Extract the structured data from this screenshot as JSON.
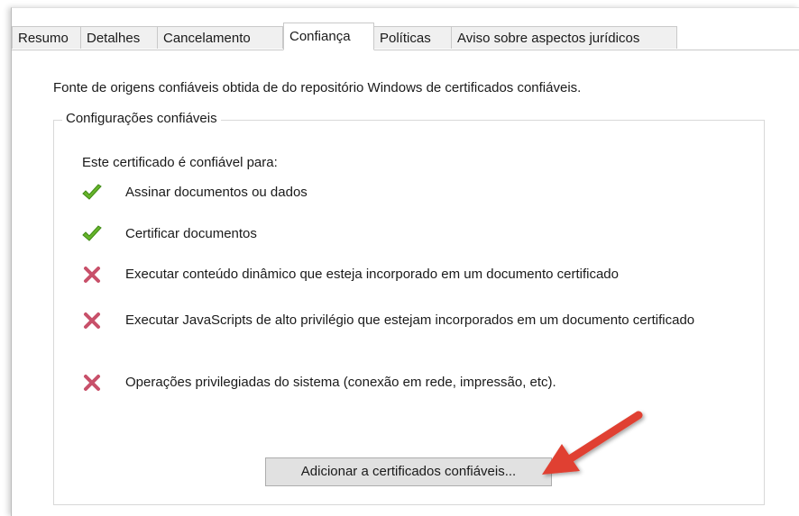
{
  "tabs": [
    {
      "label": "Resumo",
      "active": false
    },
    {
      "label": "Detalhes",
      "active": false
    },
    {
      "label": "Cancelamento",
      "active": false
    },
    {
      "label": "Confiança",
      "active": true
    },
    {
      "label": "Políticas",
      "active": false
    },
    {
      "label": "Aviso sobre aspectos jurídicos",
      "active": false
    }
  ],
  "intro_text": "Fonte de origens confiáveis obtida de do repositório Windows de certificados confiáveis.",
  "group": {
    "legend": "Configurações confiáveis",
    "subtitle": "Este certificado é confiável para:",
    "items": [
      {
        "icon": "check-icon",
        "text": "Assinar documentos ou dados"
      },
      {
        "icon": "check-icon",
        "text": "Certificar documentos"
      },
      {
        "icon": "cross-icon",
        "text": "Executar conteúdo dinâmico que esteja incorporado em um documento certificado"
      },
      {
        "icon": "cross-icon",
        "text": "Executar JavaScripts de alto privilégio que estejam incorporados em um documento certificado"
      },
      {
        "icon": "cross-icon",
        "text": "Operações privilegiadas do sistema (conexão em rede, impressão, etc)."
      }
    ],
    "add_button_label": "Adicionar a certificados confiáveis..."
  },
  "colors": {
    "check": "#66b42a",
    "cross": "#c8506a",
    "annotation_arrow": "#e04030"
  }
}
